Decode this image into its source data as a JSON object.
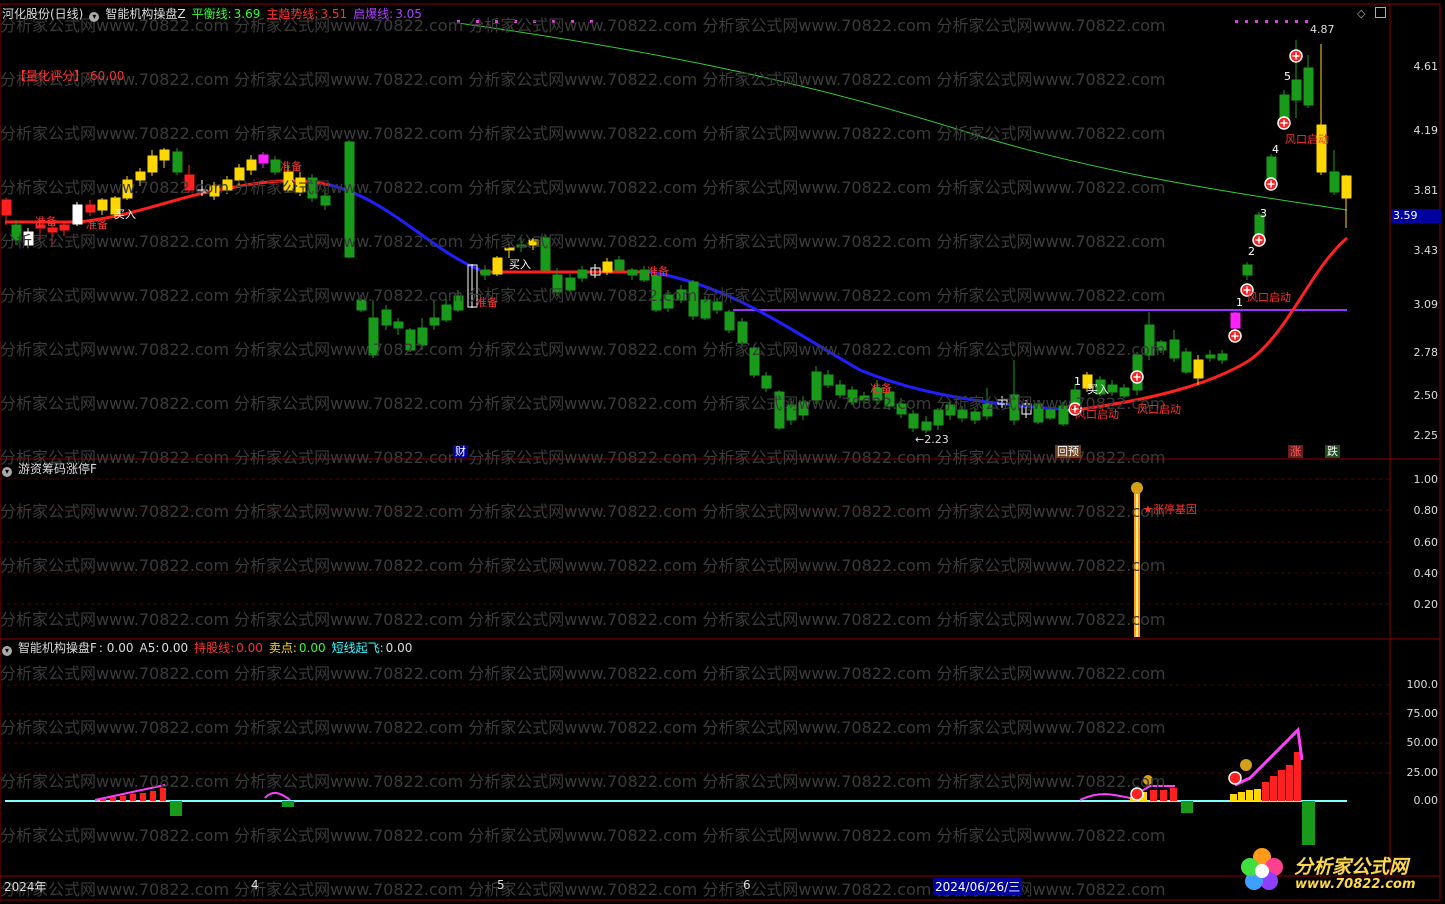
{
  "top_header": {
    "stock_name": "河化股份(日线)",
    "indicator_name": "智能机构操盘Z",
    "balance_label": "平衡线:",
    "balance_value": "3.69",
    "trend_label": "主趋势线:",
    "trend_value": "3.51",
    "launch_label": "启爆线:",
    "launch_value": "3.05"
  },
  "quant_score": "【量化评分】:60.00",
  "watermark": "分析家公式网www.70822.com 分析家公式网www.70822.com 分析家公式网www.70822.com 分析家公式网www.70822.com 分析家公式网www.70822.com",
  "price_axis": [
    "4.61",
    "4.19",
    "3.81",
    "3.43",
    "3.09",
    "2.78",
    "2.50",
    "2.25"
  ],
  "current_price_tag": "3.59",
  "high_label": "4.87",
  "low_label": "←2.23",
  "annotations": {
    "buy1": "买入",
    "buy2": "买入",
    "buy3": "买入",
    "ready1": "准备",
    "ready2": "准备",
    "ready3": "准备",
    "ready4": "准备",
    "ready5": "准备",
    "ready6": "准备",
    "wind1": "风口启动",
    "wind2": "风口启动",
    "wind3": "风口启动",
    "wind4": "风口启动",
    "n1": "1",
    "n2": "2",
    "n3": "3",
    "n4": "4",
    "n5": "5",
    "n6": "1"
  },
  "bottom_badges": {
    "cai": "财",
    "huiyu": "回预",
    "zhang": "涨",
    "die": "跌"
  },
  "panel2": {
    "title": "游资筹码涨停F",
    "gene_label": "★涨停基因",
    "axis": [
      "1.00",
      "0.80",
      "0.60",
      "0.40",
      "0.20"
    ]
  },
  "panel3": {
    "title": "智能机构操盘F",
    "f_label": ": 0.00",
    "a5_label": "A5:",
    "a5_value": "0.00",
    "hold_label": "持股线:",
    "hold_value": "0.00",
    "sell_label": "卖点:",
    "sell_value": "0.00",
    "short_label": "短线起飞:",
    "short_value": "0.00",
    "axis": [
      "100.0",
      "75.00",
      "50.00",
      "25.00",
      "0.00"
    ]
  },
  "time_axis": {
    "year": "2024年",
    "m4": "4",
    "m5": "5",
    "m6": "6",
    "cursor_date": "2024/06/26/三"
  },
  "logo": {
    "name": "分析家公式网",
    "url": "www.70822.com"
  },
  "colors": {
    "up": "#ff2020",
    "down": "#1a9a1a",
    "yellow": "#ffd700",
    "blue_line": "#2020ff",
    "red_line": "#ff2020",
    "green_line": "#33cc33",
    "purple_line": "#9933ff",
    "grid": "#8b0000"
  }
}
